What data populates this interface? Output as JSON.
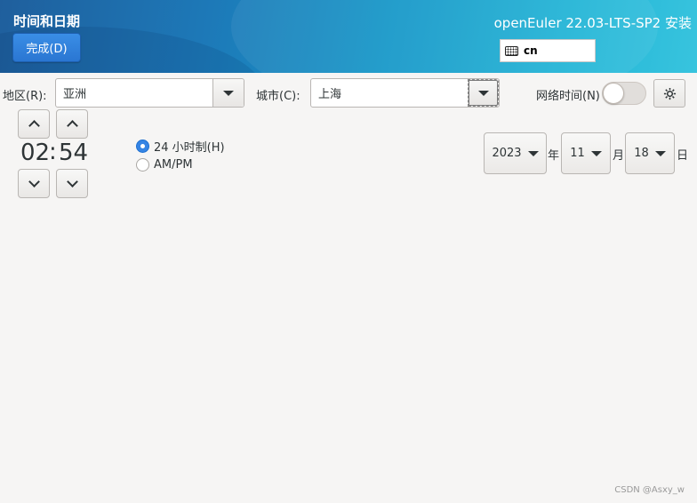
{
  "header": {
    "title": "时间和日期",
    "done_label": "完成(D)",
    "product": "openEuler 22.03-LTS-SP2 安装",
    "keyboard_layout": "cn"
  },
  "location": {
    "region_label": "地区(R):",
    "region_value": "亚洲",
    "city_label": "城市(C):",
    "city_value": "上海",
    "network_time_label": "网络时间(N)",
    "network_time_enabled": false
  },
  "time": {
    "hours": "02",
    "separator": ":",
    "minutes": "54"
  },
  "time_format": {
    "option_24h": "24 小时制(H)",
    "option_ampm": "AM/PM",
    "selected": "24h"
  },
  "date": {
    "year": "2023",
    "year_unit": "年",
    "month": "11",
    "month_unit": "月",
    "day": "18",
    "day_unit": "日"
  },
  "watermark": "CSDN @Asxy_w",
  "icons": {
    "keyboard": "keyboard-icon",
    "gear": "gear-icon",
    "dropdown": "chevron-down-icon",
    "up": "chevron-up-icon",
    "down": "chevron-down-icon"
  }
}
